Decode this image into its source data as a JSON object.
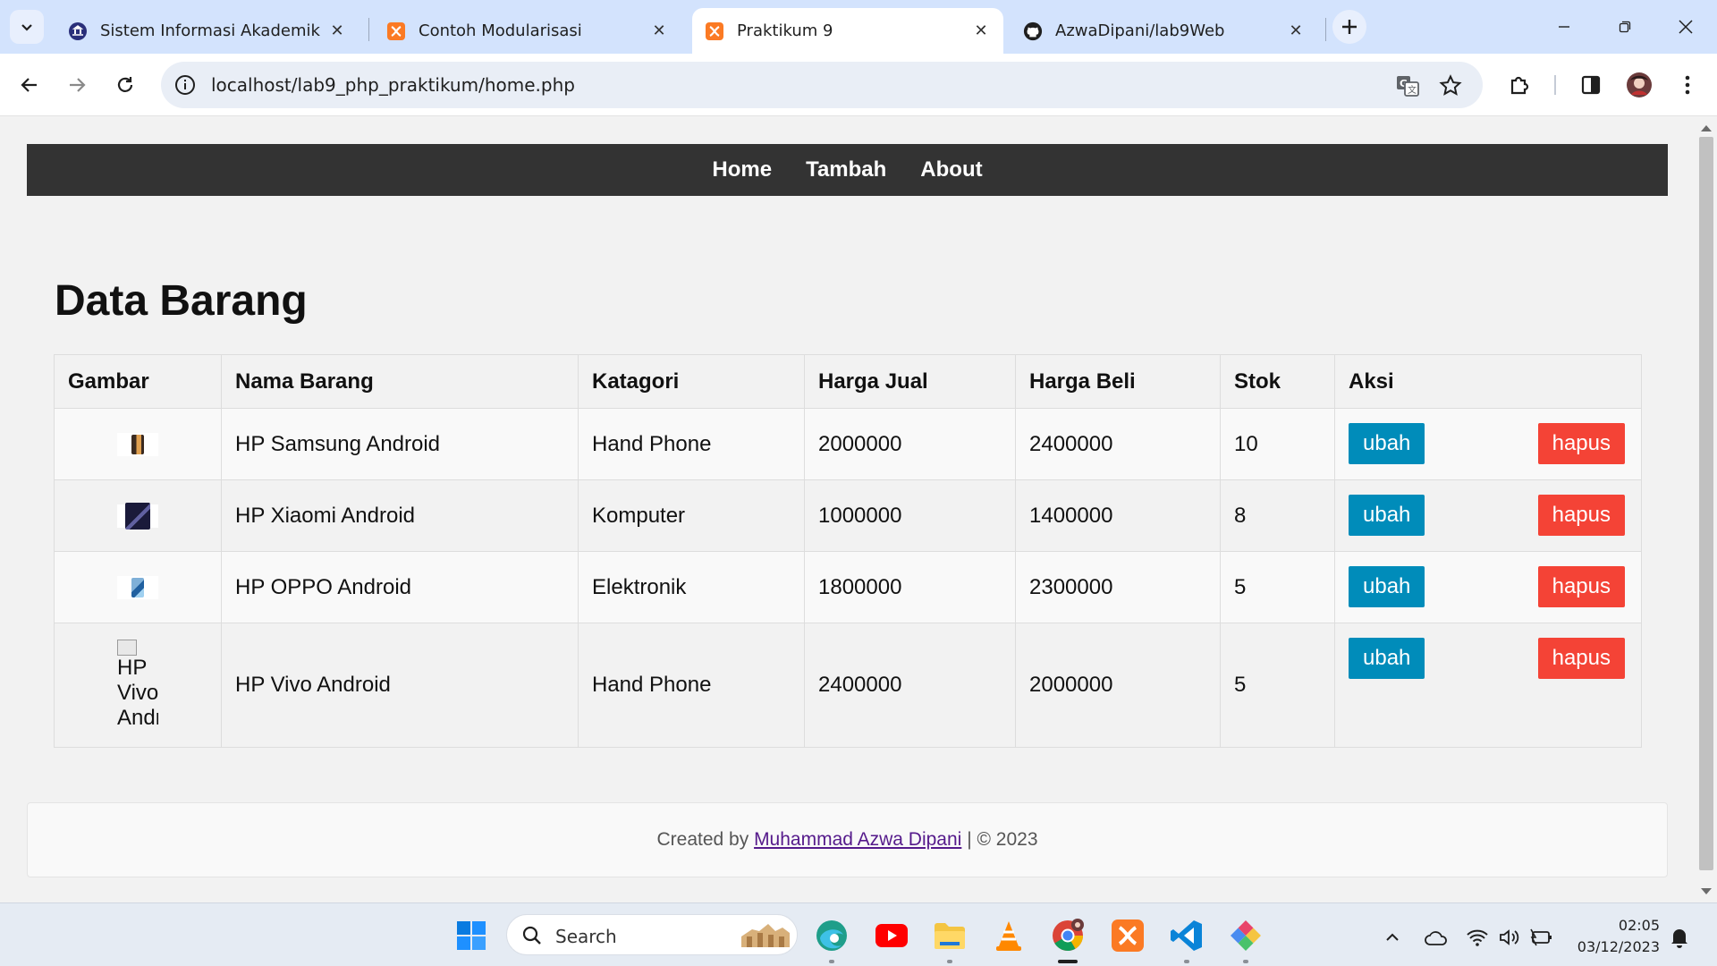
{
  "browser": {
    "tabs": [
      {
        "title": "Sistem Informasi Akademik",
        "icon": "university-icon"
      },
      {
        "title": "Contoh Modularisasi",
        "icon": "xampp-icon"
      },
      {
        "title": "Praktikum 9",
        "icon": "xampp-icon",
        "active": true
      },
      {
        "title": "AzwaDipani/lab9Web",
        "icon": "github-icon"
      }
    ],
    "url": "localhost/lab9_php_praktikum/home.php"
  },
  "site": {
    "nav": [
      "Home",
      "Tambah",
      "About"
    ],
    "title": "Data Barang",
    "table": {
      "headers": [
        "Gambar",
        "Nama Barang",
        "Katagori",
        "Harga Jual",
        "Harga Beli",
        "Stok",
        "Aksi"
      ],
      "rows": [
        {
          "nama": "HP Samsung Android",
          "kategori": "Hand Phone",
          "harga_jual": "2000000",
          "harga_beli": "2400000",
          "stok": "10"
        },
        {
          "nama": "HP Xiaomi Android",
          "kategori": "Komputer",
          "harga_jual": "1000000",
          "harga_beli": "1400000",
          "stok": "8"
        },
        {
          "nama": "HP OPPO Android",
          "kategori": "Elektronik",
          "harga_jual": "1800000",
          "harga_beli": "2300000",
          "stok": "5"
        },
        {
          "nama": "HP Vivo Android",
          "kategori": "Hand Phone",
          "harga_jual": "2400000",
          "harga_beli": "2000000",
          "stok": "5",
          "img_alt": "HP Vivo Andr"
        }
      ],
      "btn_edit": "ubah",
      "btn_delete": "hapus"
    },
    "footer": {
      "prefix": "Created by",
      "author": "Muhammad Azwa Dipani",
      "suffix": "| © 2023"
    }
  },
  "taskbar": {
    "search_label": "Search",
    "time": "02:05",
    "date": "03/12/2023"
  },
  "colors": {
    "nav_bg": "#333333",
    "btn_ubah": "#008cba",
    "btn_hapus": "#f44336",
    "tabstrip": "#d3e3fd"
  }
}
